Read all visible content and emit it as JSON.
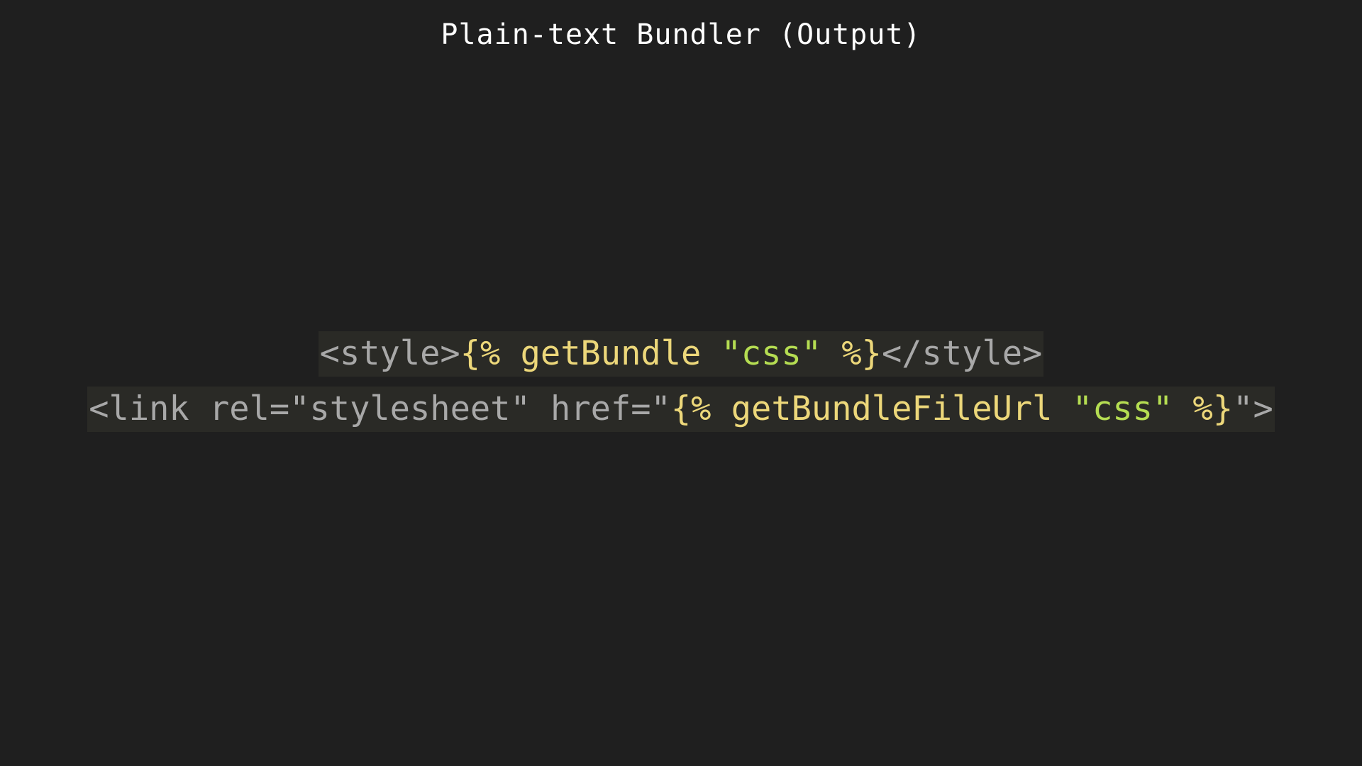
{
  "title": "Plain-text Bundler (Output)",
  "code_lines": [
    {
      "tokens": [
        {
          "text": "<style>",
          "kind": "tag"
        },
        {
          "text": "{% getBundle ",
          "kind": "tmpl"
        },
        {
          "text": "\"css\"",
          "kind": "str"
        },
        {
          "text": " %}",
          "kind": "tmpl"
        },
        {
          "text": "</style>",
          "kind": "tag"
        }
      ]
    },
    {
      "tokens": [
        {
          "text": "<link rel=\"stylesheet\" href=\"",
          "kind": "tag"
        },
        {
          "text": "{% getBundleFileUrl ",
          "kind": "tmpl"
        },
        {
          "text": "\"css\"",
          "kind": "str"
        },
        {
          "text": " %}",
          "kind": "tmpl"
        },
        {
          "text": "\">",
          "kind": "tag"
        }
      ]
    }
  ],
  "colors": {
    "background": "#1f1f1f",
    "line_highlight": "#2a2a26",
    "tag_text": "#a8a8a8",
    "template_text": "#ecd77a",
    "string_text": "#b5dd52",
    "title_text": "#ffffff"
  }
}
